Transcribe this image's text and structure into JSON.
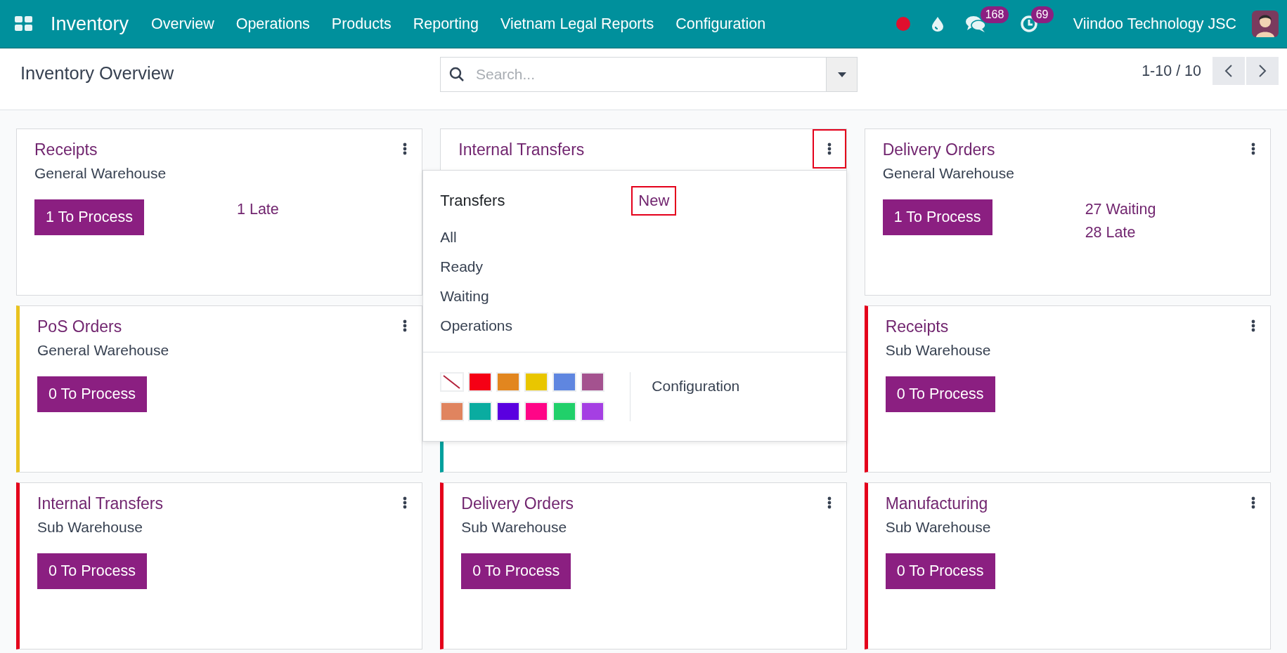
{
  "navbar": {
    "app_name": "Inventory",
    "menu": [
      "Overview",
      "Operations",
      "Products",
      "Reporting",
      "Vietnam Legal Reports",
      "Configuration"
    ],
    "chat_badge": "168",
    "activity_badge": "69",
    "company": "Viindoo Technology JSC"
  },
  "control_panel": {
    "title": "Inventory Overview",
    "search": {
      "placeholder": "Search..."
    },
    "pager": "1-10 / 10"
  },
  "cards": [
    {
      "title": "Receipts",
      "subtitle": "General Warehouse",
      "button": "1 To Process",
      "links": [
        "1 Late"
      ]
    },
    {
      "title": "Internal Transfers",
      "highlighted": true,
      "menu": {
        "header": "Transfers",
        "new_label": "New",
        "new_highlighted": true,
        "items": [
          "All",
          "Ready",
          "Waiting",
          "Operations"
        ],
        "swatches": [
          {
            "kind": "none"
          },
          {
            "kind": "color",
            "color": "#f50015"
          },
          {
            "kind": "color",
            "color": "#e2861f"
          },
          {
            "kind": "color",
            "color": "#e9c600"
          },
          {
            "kind": "color",
            "color": "#5f86e0"
          },
          {
            "kind": "color",
            "color": "#a4528f"
          },
          {
            "kind": "color",
            "color": "#e0845f"
          },
          {
            "kind": "color",
            "color": "#0aaca0"
          },
          {
            "kind": "color",
            "color": "#5a00e0"
          },
          {
            "kind": "color",
            "color": "#ff0587"
          },
          {
            "kind": "color",
            "color": "#21d06a"
          },
          {
            "kind": "color",
            "color": "#a53fe3"
          }
        ],
        "configuration": "Configuration"
      }
    },
    {
      "title": "Delivery Orders",
      "subtitle": "General Warehouse",
      "button": "1 To Process",
      "links": [
        "27 Waiting",
        "28 Late"
      ]
    },
    {
      "title": "PoS Orders",
      "subtitle": "General Warehouse",
      "button": "0 To Process",
      "color": "#e9c21f"
    },
    {
      "color": "#00a09d"
    },
    {
      "title": "Receipts",
      "subtitle": "Sub Warehouse",
      "button": "0 To Process",
      "color": "#e4001b"
    },
    {
      "title": "Internal Transfers",
      "subtitle": "Sub Warehouse",
      "button": "0 To Process",
      "color": "#e4001b"
    },
    {
      "title": "Delivery Orders",
      "subtitle": "Sub Warehouse",
      "button": "0 To Process",
      "color": "#e4001b"
    },
    {
      "title": "Manufacturing",
      "subtitle": "Sub Warehouse",
      "button": "0 To Process",
      "color": "#e4001b"
    }
  ]
}
